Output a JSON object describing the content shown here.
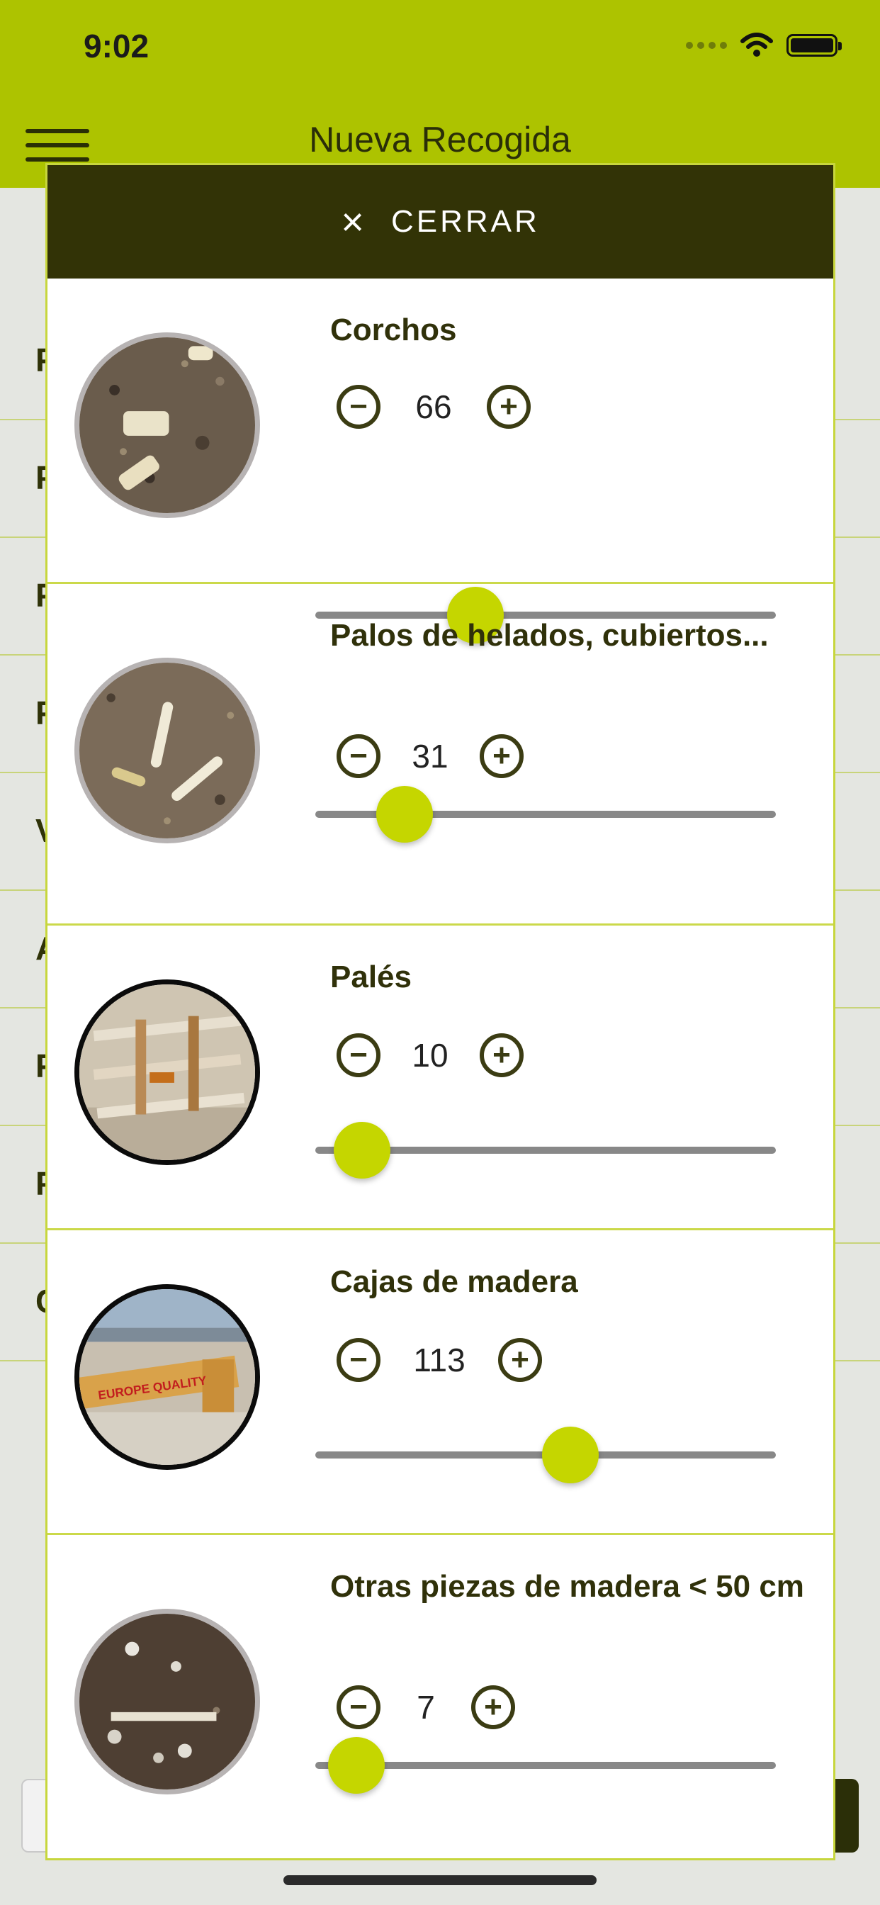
{
  "status": {
    "time": "9:02"
  },
  "header": {
    "title": "Nueva Recogida"
  },
  "background_rows": [
    "P",
    "P",
    "P",
    "P",
    "V",
    "A",
    "P",
    "P",
    "C"
  ],
  "modal": {
    "close_icon": "×",
    "close_label": "CERRAR",
    "items": [
      {
        "title": "Corchos",
        "value": "66",
        "slider_fraction": 0.35
      },
      {
        "title": "Palos de helados, cubiertos...",
        "value": "31",
        "slider_fraction": 0.19
      },
      {
        "title": "Palés",
        "value": "10",
        "slider_fraction": 0.1
      },
      {
        "title": "Cajas de madera",
        "value": "113",
        "slider_fraction": 0.55
      },
      {
        "title": "Otras piezas de madera < 50 cm",
        "value": "7",
        "slider_fraction": 0.09
      }
    ]
  },
  "stepper_icons": {
    "minus": "minus-circle-icon",
    "plus": "plus-circle-icon"
  }
}
